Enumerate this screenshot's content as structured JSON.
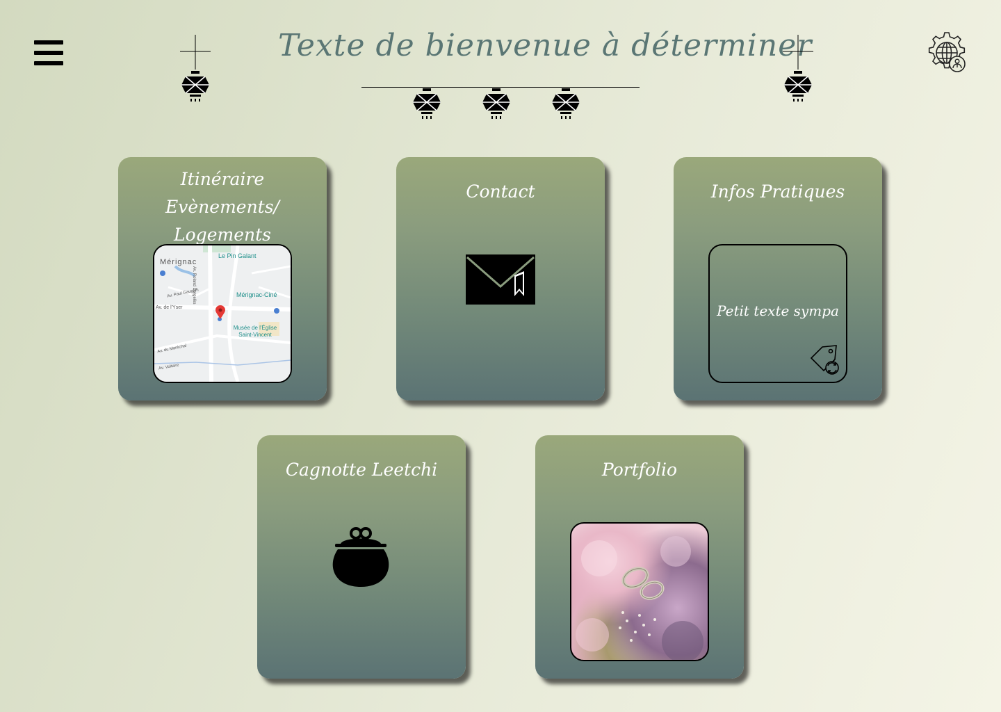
{
  "header": {
    "title": "Texte de bienvenue à déterminer",
    "menu_icon": "hamburger-menu-icon",
    "settings_icon": "globe-gear-settings-icon",
    "decor_icon": "hanging-lantern-icon"
  },
  "cards": {
    "itineraire": {
      "title": "Itinéraire Evènements/ Logements",
      "map": {
        "town": "Mérignac",
        "poi_1": "Le Pin Galant",
        "poi_2": "Mérignac-Ciné",
        "poi_3": "Musée de l'Église Saint-Vincent",
        "street_1": "Av. de l'Yser",
        "street_2": "Av. Roland Dorgelès",
        "street_3": "Av. Paul Gauguin",
        "street_4": "Av. du Maréchal",
        "street_5": "Av. Voltaire"
      }
    },
    "contact": {
      "title": "Contact",
      "icon": "envelope-icon"
    },
    "infos": {
      "title": "Infos Pratiques",
      "text": "Petit texte sympa",
      "icon": "price-tag-refresh-icon"
    },
    "cagnotte": {
      "title": "Cagnotte Leetchi",
      "icon": "coin-purse-icon"
    },
    "portfolio": {
      "title": "Portfolio",
      "image": "wedding-rings-on-flowers-photo"
    }
  },
  "colors": {
    "background": "#e7ead8",
    "card_top": "#9aa87b",
    "card_bottom": "#5b7374",
    "title": "#5a7674"
  }
}
